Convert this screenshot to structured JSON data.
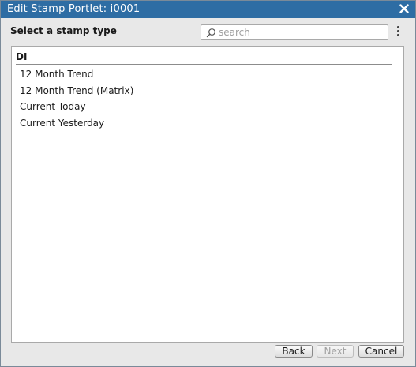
{
  "window": {
    "title": "Edit Stamp Portlet: i0001"
  },
  "header": {
    "prompt": "Select a stamp type",
    "search": {
      "placeholder": "search",
      "value": ""
    },
    "icons": {
      "search": "search-icon",
      "more": "more-vertical-icon",
      "close": "close-icon"
    }
  },
  "list": {
    "group": "DI",
    "items": [
      {
        "label": "12 Month Trend"
      },
      {
        "label": "12 Month Trend (Matrix)"
      },
      {
        "label": "Current Today"
      },
      {
        "label": "Current Yesterday"
      }
    ]
  },
  "footer": {
    "back_label": "Back",
    "next_label": "Next",
    "cancel_label": "Cancel",
    "next_disabled": true
  },
  "colors": {
    "titlebar": "#2e6da4",
    "dialog_bg": "#e8e8e8",
    "panel_bg": "#ffffff"
  }
}
